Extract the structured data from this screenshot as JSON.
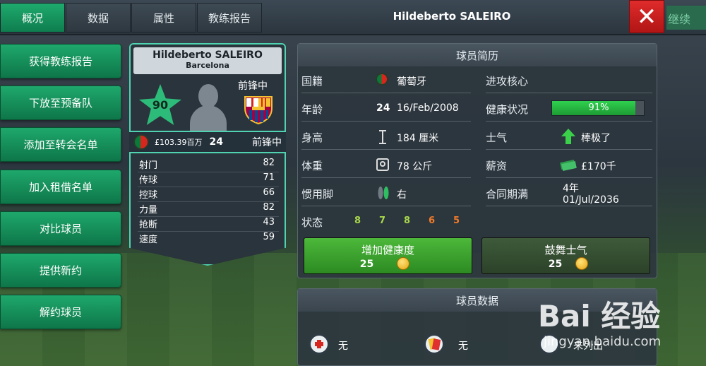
{
  "tabs": [
    "概况",
    "数据",
    "属性",
    "教练报告"
  ],
  "header": {
    "player_name": "Hildeberto SALEIRO",
    "continue_label": "继续"
  },
  "side_menu": [
    "获得教练报告",
    "下放至预备队",
    "添加至转会名单",
    "加入租借名单",
    "对比球员",
    "提供新约",
    "解约球员"
  ],
  "card": {
    "name": "Hildeberto SALEIRO",
    "club": "Barcelona",
    "rating": "90",
    "position": "前锋中",
    "value": "£103.39百万",
    "age": "24",
    "position_bottom": "前锋中",
    "stats": [
      {
        "label": "射门",
        "value": "82"
      },
      {
        "label": "传球",
        "value": "71"
      },
      {
        "label": "控球",
        "value": "66"
      },
      {
        "label": "力量",
        "value": "82"
      },
      {
        "label": "抢断",
        "value": "43"
      },
      {
        "label": "速度",
        "value": "59"
      }
    ]
  },
  "profile": {
    "title": "球员简历",
    "nationality_label": "国籍",
    "nationality": "葡萄牙",
    "age_label": "年龄",
    "age": "24",
    "dob": "16/Feb/2008",
    "height_label": "身高",
    "height": "184 厘米",
    "weight_label": "体重",
    "weight": "78 公斤",
    "foot_label": "惯用脚",
    "foot": "右",
    "status_label": "状态",
    "status_values": [
      "8",
      "7",
      "8",
      "6",
      "5"
    ],
    "role_label": "进攻核心",
    "health_label": "健康状况",
    "health": "91%",
    "health_level": 0.91,
    "morale_label": "士气",
    "morale": "棒极了",
    "wage_label": "薪资",
    "wage": "£170千",
    "contract_label": "合同期满",
    "contract_years": "4年",
    "contract_date": "01/Jul/2036"
  },
  "actions": {
    "health_btn": "增加健康度",
    "health_cost": "25",
    "morale_btn": "鼓舞士气",
    "morale_cost": "25"
  },
  "player_data": {
    "title": "球员数据",
    "injury_value": "无",
    "card_value": "无",
    "third_value": "未列出"
  },
  "watermark": {
    "main": "Bai 经验",
    "sub": "jingyan.baidu.com"
  },
  "colors": {
    "accent_green": "#1ea86c",
    "close_red": "#e02b2b",
    "health_green": "#2fd04f"
  }
}
